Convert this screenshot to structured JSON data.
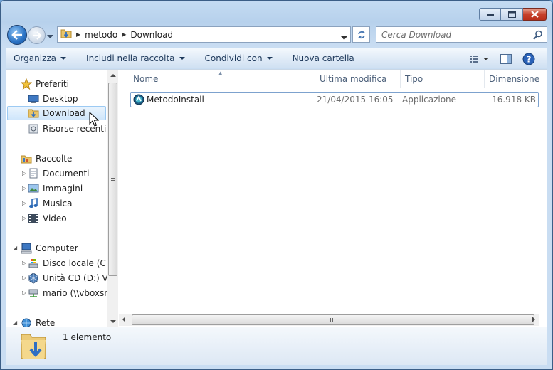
{
  "window": {
    "caption_buttons": [
      "minimize",
      "maximize",
      "close"
    ]
  },
  "address_bar": {
    "breadcrumbs": [
      "metodo",
      "Download"
    ]
  },
  "search": {
    "placeholder": "Cerca Download"
  },
  "command_bar": {
    "organize": "Organizza",
    "include": "Includi nella raccolta",
    "share": "Condividi con",
    "new_folder": "Nuova cartella"
  },
  "nav_tree": {
    "favorites": "Preferiti",
    "desktop": "Desktop",
    "download": "Download",
    "recent": "Risorse recenti",
    "libraries": "Raccolte",
    "documents": "Documenti",
    "pictures": "Immagini",
    "music": "Musica",
    "video": "Video",
    "computer": "Computer",
    "disk_c": "Disco locale (C:)",
    "cd_d": "Unità CD (D:) Virt",
    "network_share": "mario (\\\\vboxsrv",
    "network": "Rete"
  },
  "columns": {
    "name": "Nome",
    "modified": "Ultima modifica",
    "type": "Tipo",
    "size": "Dimensione"
  },
  "files": [
    {
      "name": "MetodoInstall",
      "modified": "21/04/2015 16:05",
      "type": "Applicazione",
      "size": "16.918 KB",
      "icon": "app-installer-icon"
    }
  ],
  "status": {
    "count": "1 elemento"
  },
  "colors": {
    "selection": "#cfe6fb",
    "accent": "#2a72c4",
    "close_red": "#c7412c"
  }
}
